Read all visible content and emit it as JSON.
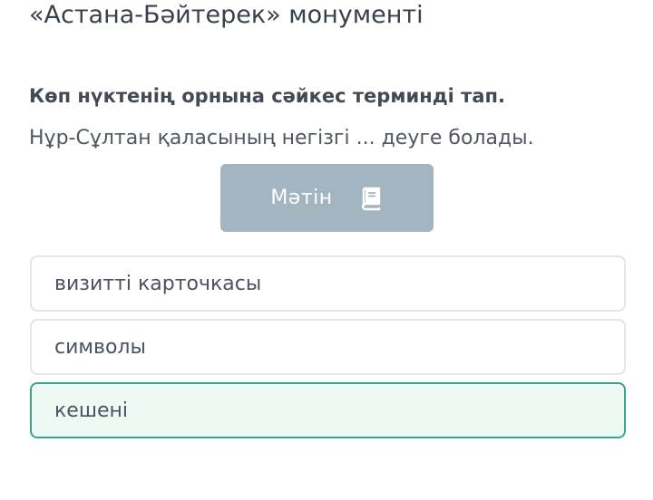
{
  "header": {
    "title": "«Астана-Бәйтерек» монументі"
  },
  "task": {
    "instruction": "Көп нүктенің орнына сәйкес терминді тап.",
    "question": "Нұр-Сұлтан қаласының негізгі ... деуге болады."
  },
  "text_button": {
    "label": "Мәтін",
    "icon": "book-icon"
  },
  "answers": [
    {
      "label": "визитті карточкасы",
      "selected": false
    },
    {
      "label": "символы",
      "selected": false
    },
    {
      "label": "кешені",
      "selected": true
    }
  ],
  "colors": {
    "button_bg": "#a2b5c1",
    "option_border": "#e2e6ea",
    "selected_border": "#3aa38e",
    "selected_bg": "#edf9f3"
  }
}
